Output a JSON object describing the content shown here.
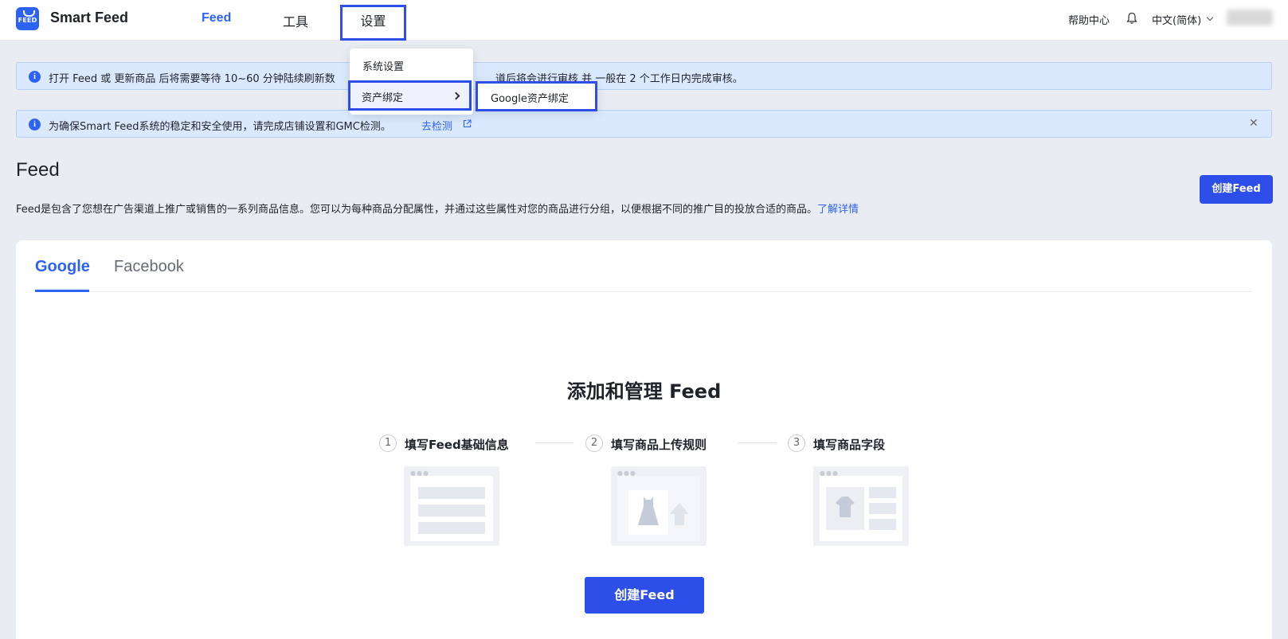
{
  "app": {
    "logo_text": "FEED",
    "brand": "Smart Feed"
  },
  "nav": {
    "feed": "Feed",
    "tools": "工具",
    "settings": "设置"
  },
  "header_right": {
    "help": "帮助中心",
    "language": "中文(简体)"
  },
  "settings_menu": {
    "items": [
      "系统设置",
      "资产绑定"
    ],
    "submenu": [
      "Google资产绑定"
    ]
  },
  "alerts": {
    "alert1_text_start": "打开 Feed 或 更新商品 后将需要等待 10~60 分钟陆续刷新数",
    "alert1_text_end": "道后将会进行审核 并 一般在 2 个工作日内完成审核。",
    "alert2_text": "为确保Smart Feed系统的稳定和安全使用，请完成店铺设置和GMC检测。",
    "alert2_link": "去检测"
  },
  "page": {
    "title": "Feed",
    "create_button": "创建Feed",
    "description": "Feed是包含了您想在广告渠道上推广或销售的一系列商品信息。您可以为每种商品分配属性，并通过这些属性对您的商品进行分组，以便根据不同的推广目的投放合适的商品。",
    "learn_more": "了解详情"
  },
  "tabs": [
    "Google",
    "Facebook"
  ],
  "empty_state": {
    "title": "添加和管理 Feed",
    "steps": [
      {
        "num": "1",
        "label": "填写Feed基础信息"
      },
      {
        "num": "2",
        "label": "填写商品上传规则"
      },
      {
        "num": "3",
        "label": "填写商品字段"
      }
    ],
    "create_button": "创建Feed"
  },
  "colors": {
    "primary": "#2d4ee8",
    "link": "#2d63f5",
    "alert_bg": "#dbe9ff",
    "page_bg": "#eaecf3"
  },
  "icons": {
    "info": "info-circle-icon",
    "bell": "bell-icon",
    "close": "close-icon",
    "external": "external-link-icon",
    "chevron": "chevron-right-icon"
  }
}
